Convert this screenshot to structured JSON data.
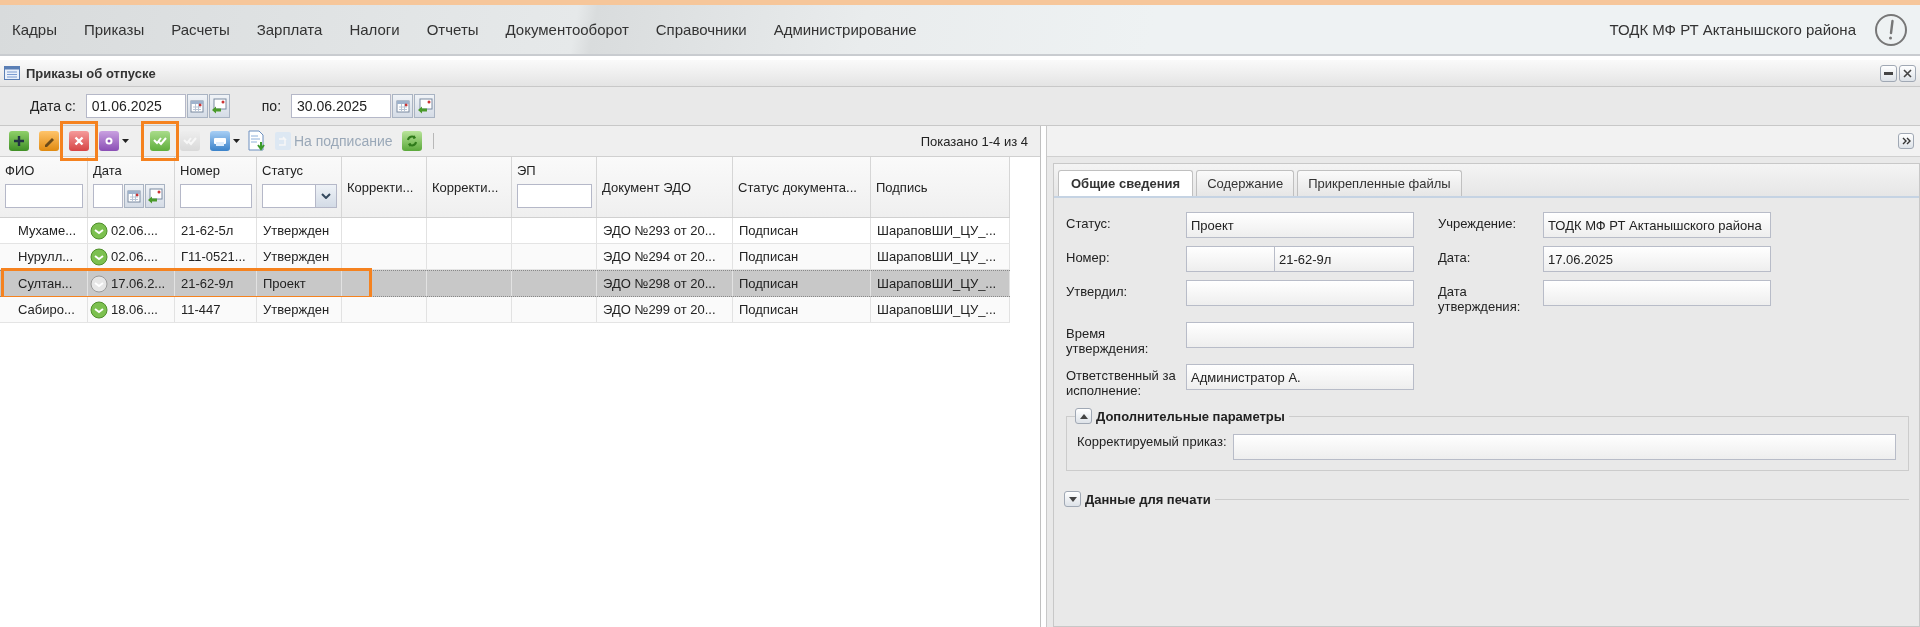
{
  "menu": {
    "items": [
      "Кадры",
      "Приказы",
      "Расчеты",
      "Зарплата",
      "Налоги",
      "Отчеты",
      "Документооборот",
      "Справочники",
      "Администрирование"
    ],
    "organization": "ТОДК МФ РТ Актанышского района"
  },
  "window": {
    "title": "Приказы об отпуске"
  },
  "filter": {
    "from_label": "Дата с:",
    "from": "01.06.2025",
    "to_label": "по:",
    "to": "30.06.2025"
  },
  "toolbar": {
    "buttons": [
      {
        "kind": "add",
        "disabled": false,
        "highlighted": false
      },
      {
        "kind": "edit",
        "disabled": false,
        "highlighted": false
      },
      {
        "kind": "delete",
        "disabled": false,
        "highlighted": true
      },
      {
        "kind": "settings",
        "disabled": false,
        "highlighted": false
      },
      {
        "kind": "approve",
        "disabled": false,
        "highlighted": true
      },
      {
        "kind": "approve",
        "disabled": true,
        "highlighted": false
      },
      {
        "kind": "print",
        "disabled": false,
        "highlighted": false
      },
      {
        "kind": "export",
        "disabled": false,
        "highlighted": false
      },
      {
        "kind": "sign",
        "label": "На подписание",
        "disabled": true,
        "highlighted": false
      },
      {
        "kind": "refresh",
        "disabled": false,
        "highlighted": false
      }
    ],
    "paging": "Показано 1-4 из 4"
  },
  "table": {
    "columns": [
      {
        "label": "ФИО",
        "kind": "text"
      },
      {
        "label": "Дата",
        "kind": "date"
      },
      {
        "label": "Номер",
        "kind": "text"
      },
      {
        "label": "Статус",
        "kind": "combo"
      },
      {
        "label": "Корректи...",
        "kind": "none"
      },
      {
        "label": "Корректи...",
        "kind": "none"
      },
      {
        "label": "ЭП",
        "kind": "text"
      },
      {
        "label": "Документ ЭДО",
        "kind": "none"
      },
      {
        "label": "Статус документа...",
        "kind": "none"
      },
      {
        "label": "Подпись",
        "kind": "none"
      }
    ],
    "rows": [
      {
        "kind": "approved",
        "selected": false,
        "highlighted": false,
        "cells": [
          "Мухаме...",
          "02.06....",
          "21-62-5л",
          "Утвержден",
          "",
          "",
          "",
          "ЭДО №293 от 20...",
          "Подписан",
          "ШараповШИ_ЦУ_..."
        ]
      },
      {
        "kind": "approved",
        "selected": false,
        "highlighted": false,
        "cells": [
          "Нурулл...",
          "02.06....",
          "Г11-0521...",
          "Утвержден",
          "",
          "",
          "",
          "ЭДО №294 от 20...",
          "Подписан",
          "ШараповШИ_ЦУ_..."
        ]
      },
      {
        "kind": "pending",
        "selected": true,
        "highlighted": true,
        "cells": [
          "Султан...",
          "17.06.2...",
          "21-62-9л",
          "Проект",
          "",
          "",
          "",
          "ЭДО №298 от 20...",
          "Подписан",
          "ШараповШИ_ЦУ_..."
        ]
      },
      {
        "kind": "approved",
        "selected": false,
        "highlighted": false,
        "cells": [
          "Сабиро...",
          "18.06....",
          "11-447",
          "Утвержден",
          "",
          "",
          "",
          "ЭДО №299 от 20...",
          "Подписан",
          "ШараповШИ_ЦУ_..."
        ]
      }
    ]
  },
  "detail": {
    "tabs": [
      {
        "label": "Общие сведения",
        "selected": true
      },
      {
        "label": "Содержание",
        "selected": false
      },
      {
        "label": "Прикрепленные файлы",
        "selected": false
      }
    ],
    "left_fields": [
      {
        "label": "Статус:",
        "value": "Проект",
        "kind": "single"
      },
      {
        "label": "Номер:",
        "value": "21-62-9л",
        "kind": "split"
      },
      {
        "label": "Утвердил:",
        "kind": "single"
      },
      {
        "label": "Время утверждения:",
        "kind": "single"
      },
      {
        "label": "Ответственный за исполнение:",
        "value": "Администратор А.",
        "kind": "single"
      }
    ],
    "right_fields": [
      {
        "label": "Учреждение:",
        "value": "ТОДК МФ РТ Актанышского района"
      },
      {
        "label": "Дата:",
        "value": "17.06.2025"
      },
      {
        "label": "Дата утверждения:"
      }
    ],
    "sections": [
      {
        "title": "Дополнительные параметры",
        "expanded": true,
        "fields": [
          {
            "label": "Корректируемый приказ:"
          }
        ]
      },
      {
        "title": "Данные для печати",
        "expanded": false
      }
    ]
  }
}
